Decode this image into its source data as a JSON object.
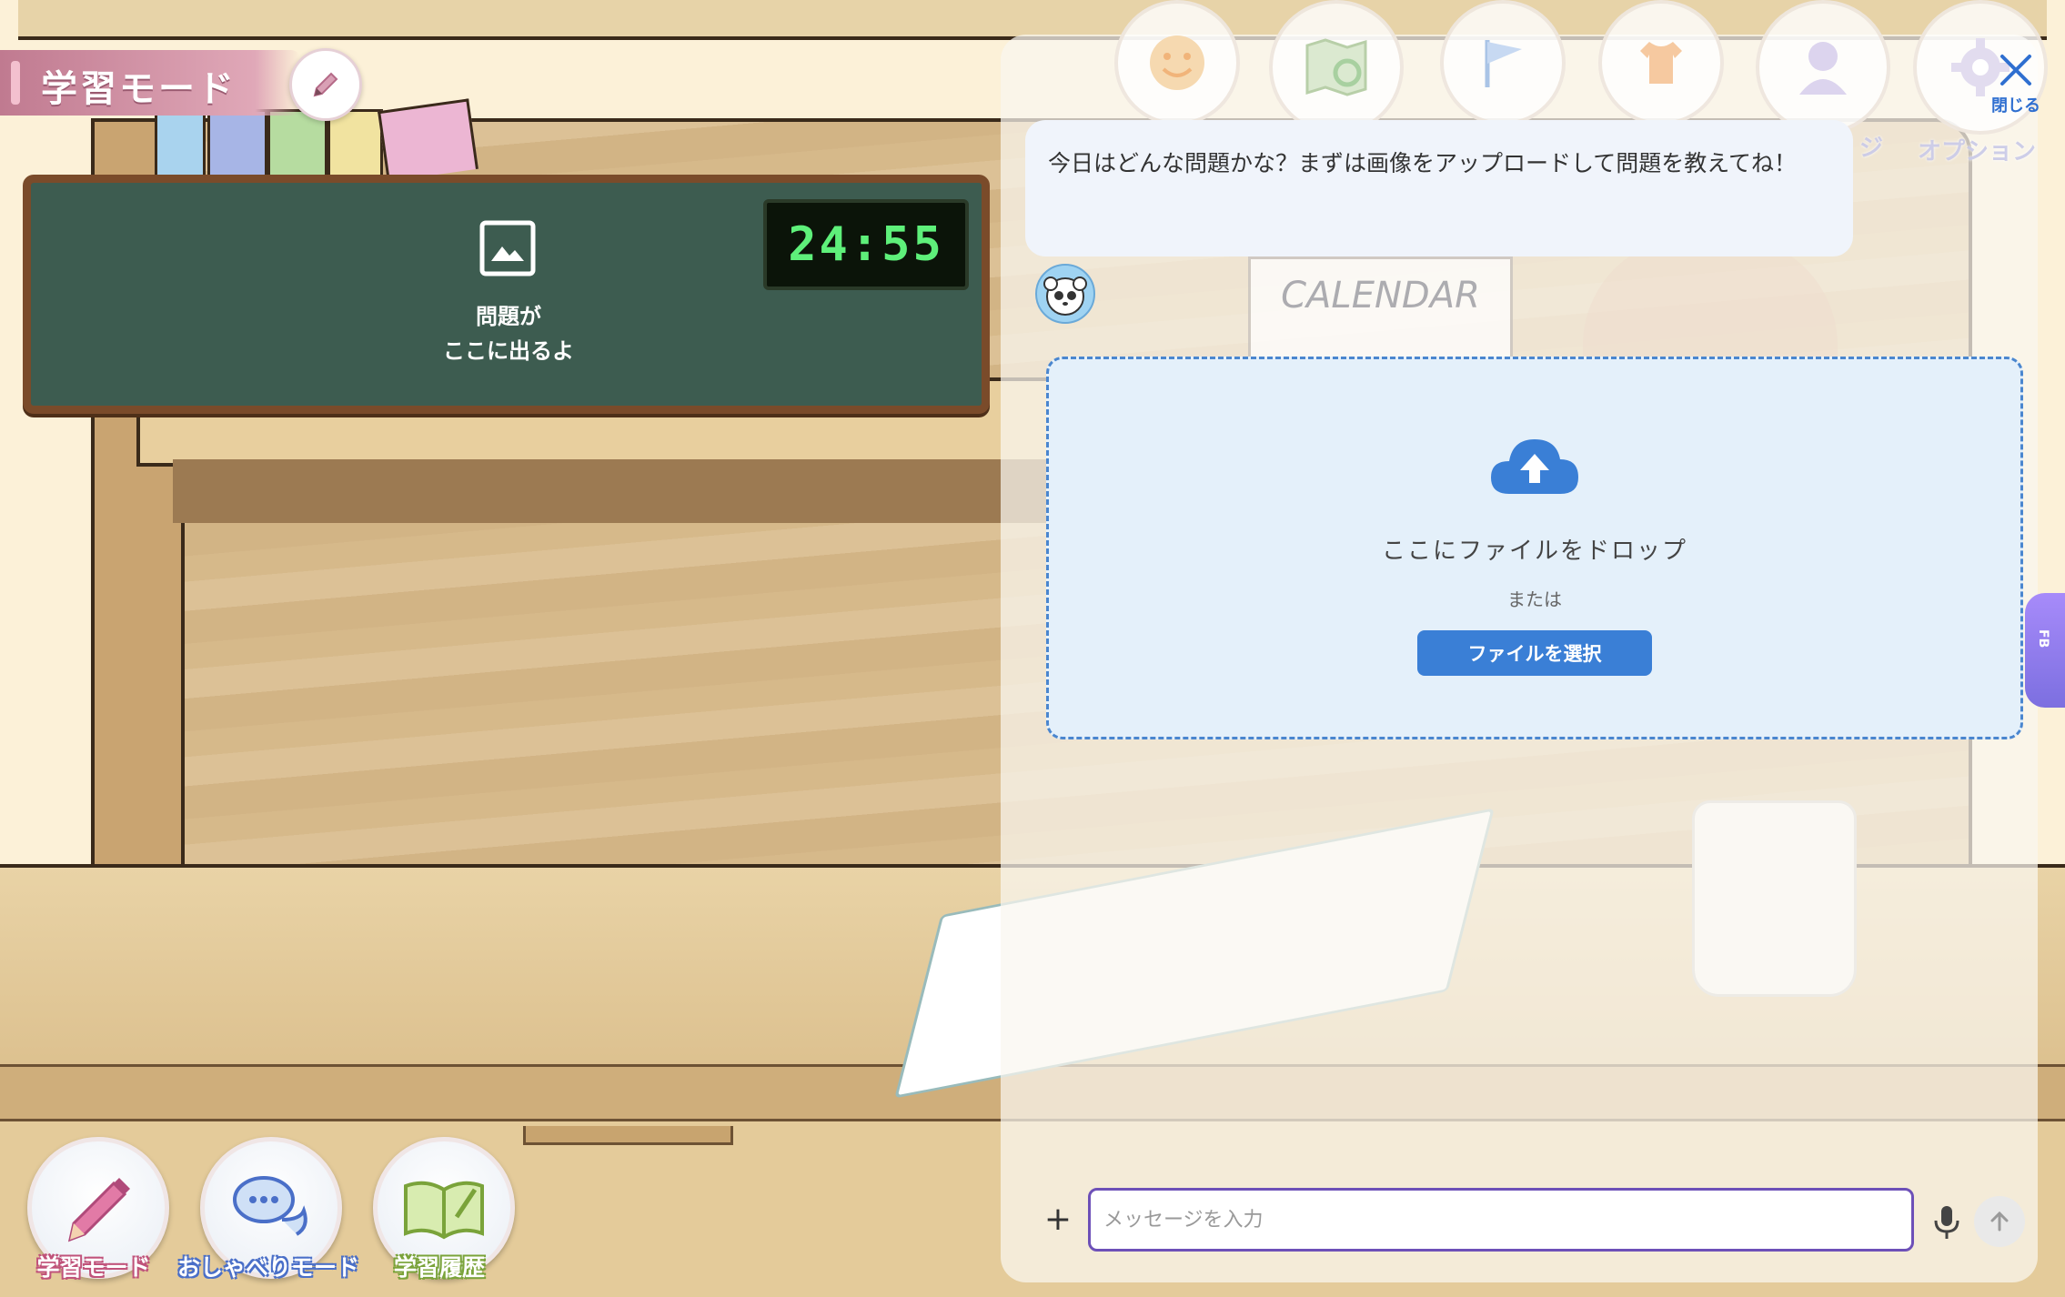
{
  "header": {
    "mode_title": "学習モード",
    "edit_icon": "pencil-icon"
  },
  "board": {
    "image_icon": "image-icon",
    "placeholder": "問題が\nここに出るよ",
    "timer": "24:55"
  },
  "top_menu": {
    "items": [
      {
        "icon": "smiley-icon",
        "label": ""
      },
      {
        "icon": "map-search-icon",
        "label": ""
      },
      {
        "icon": "flag-icon",
        "label": ""
      },
      {
        "icon": "shirt-icon",
        "label": ""
      },
      {
        "icon": "user-icon",
        "label": "ジ"
      },
      {
        "icon": "gear-icon",
        "label": "オプション"
      }
    ],
    "close_label": "閉じる"
  },
  "chat": {
    "message": "今日はどんな問題かな？まずは画像をアップロードして問題を教えてね！",
    "calendar_text": "CALENDAR"
  },
  "dropzone": {
    "icon": "cloud-upload-icon",
    "drop_text": "ここにファイルをドロップ",
    "or_text": "または",
    "select_button": "ファイルを選択"
  },
  "side_tab": {
    "label": "FB",
    "icon": "flag-icon"
  },
  "input": {
    "placeholder": "メッセージを入力",
    "value": ""
  },
  "bottom_modes": [
    {
      "label": "学習モード",
      "icon": "pencil-icon"
    },
    {
      "label": "おしゃべりモード",
      "icon": "chat-bubbles-icon"
    },
    {
      "label": "学習履歴",
      "icon": "book-icon"
    }
  ],
  "colors": {
    "accent_blue": "#3a7fd6",
    "timer_green": "#5ef07a",
    "board_green": "#3d5c50",
    "input_border": "#6d50b8"
  }
}
